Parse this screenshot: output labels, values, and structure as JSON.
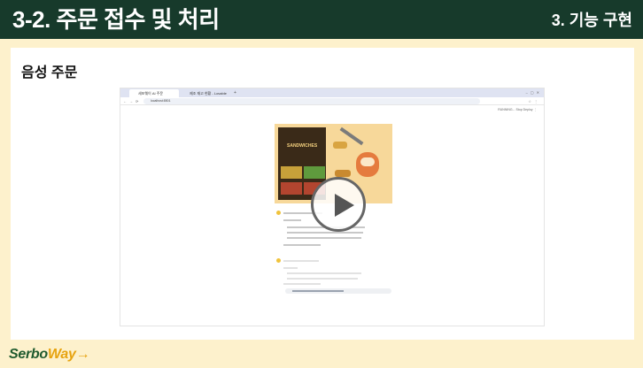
{
  "header": {
    "title": "3-2. 주문 접수 및 처리",
    "section": "3. 기능 구현",
    "bg_color": "#173a2b"
  },
  "content": {
    "subtitle": "음성 주문",
    "bg_color": "#fdf1cc"
  },
  "screenshot": {
    "tabs": [
      "세포웨이 AI 주문",
      "제조 재고 현황 - Lovable"
    ],
    "url": "localhost:8501",
    "toolbar_text": "RUNNING...   Stop   Deploy   ⋮",
    "menu_title": "SANDWICHES",
    "play_icon": "play-icon"
  },
  "footer": {
    "logo_part1": "Serbo",
    "logo_part2": "Way",
    "logo_arrow": "→",
    "accent_color": "#e7a30f"
  }
}
